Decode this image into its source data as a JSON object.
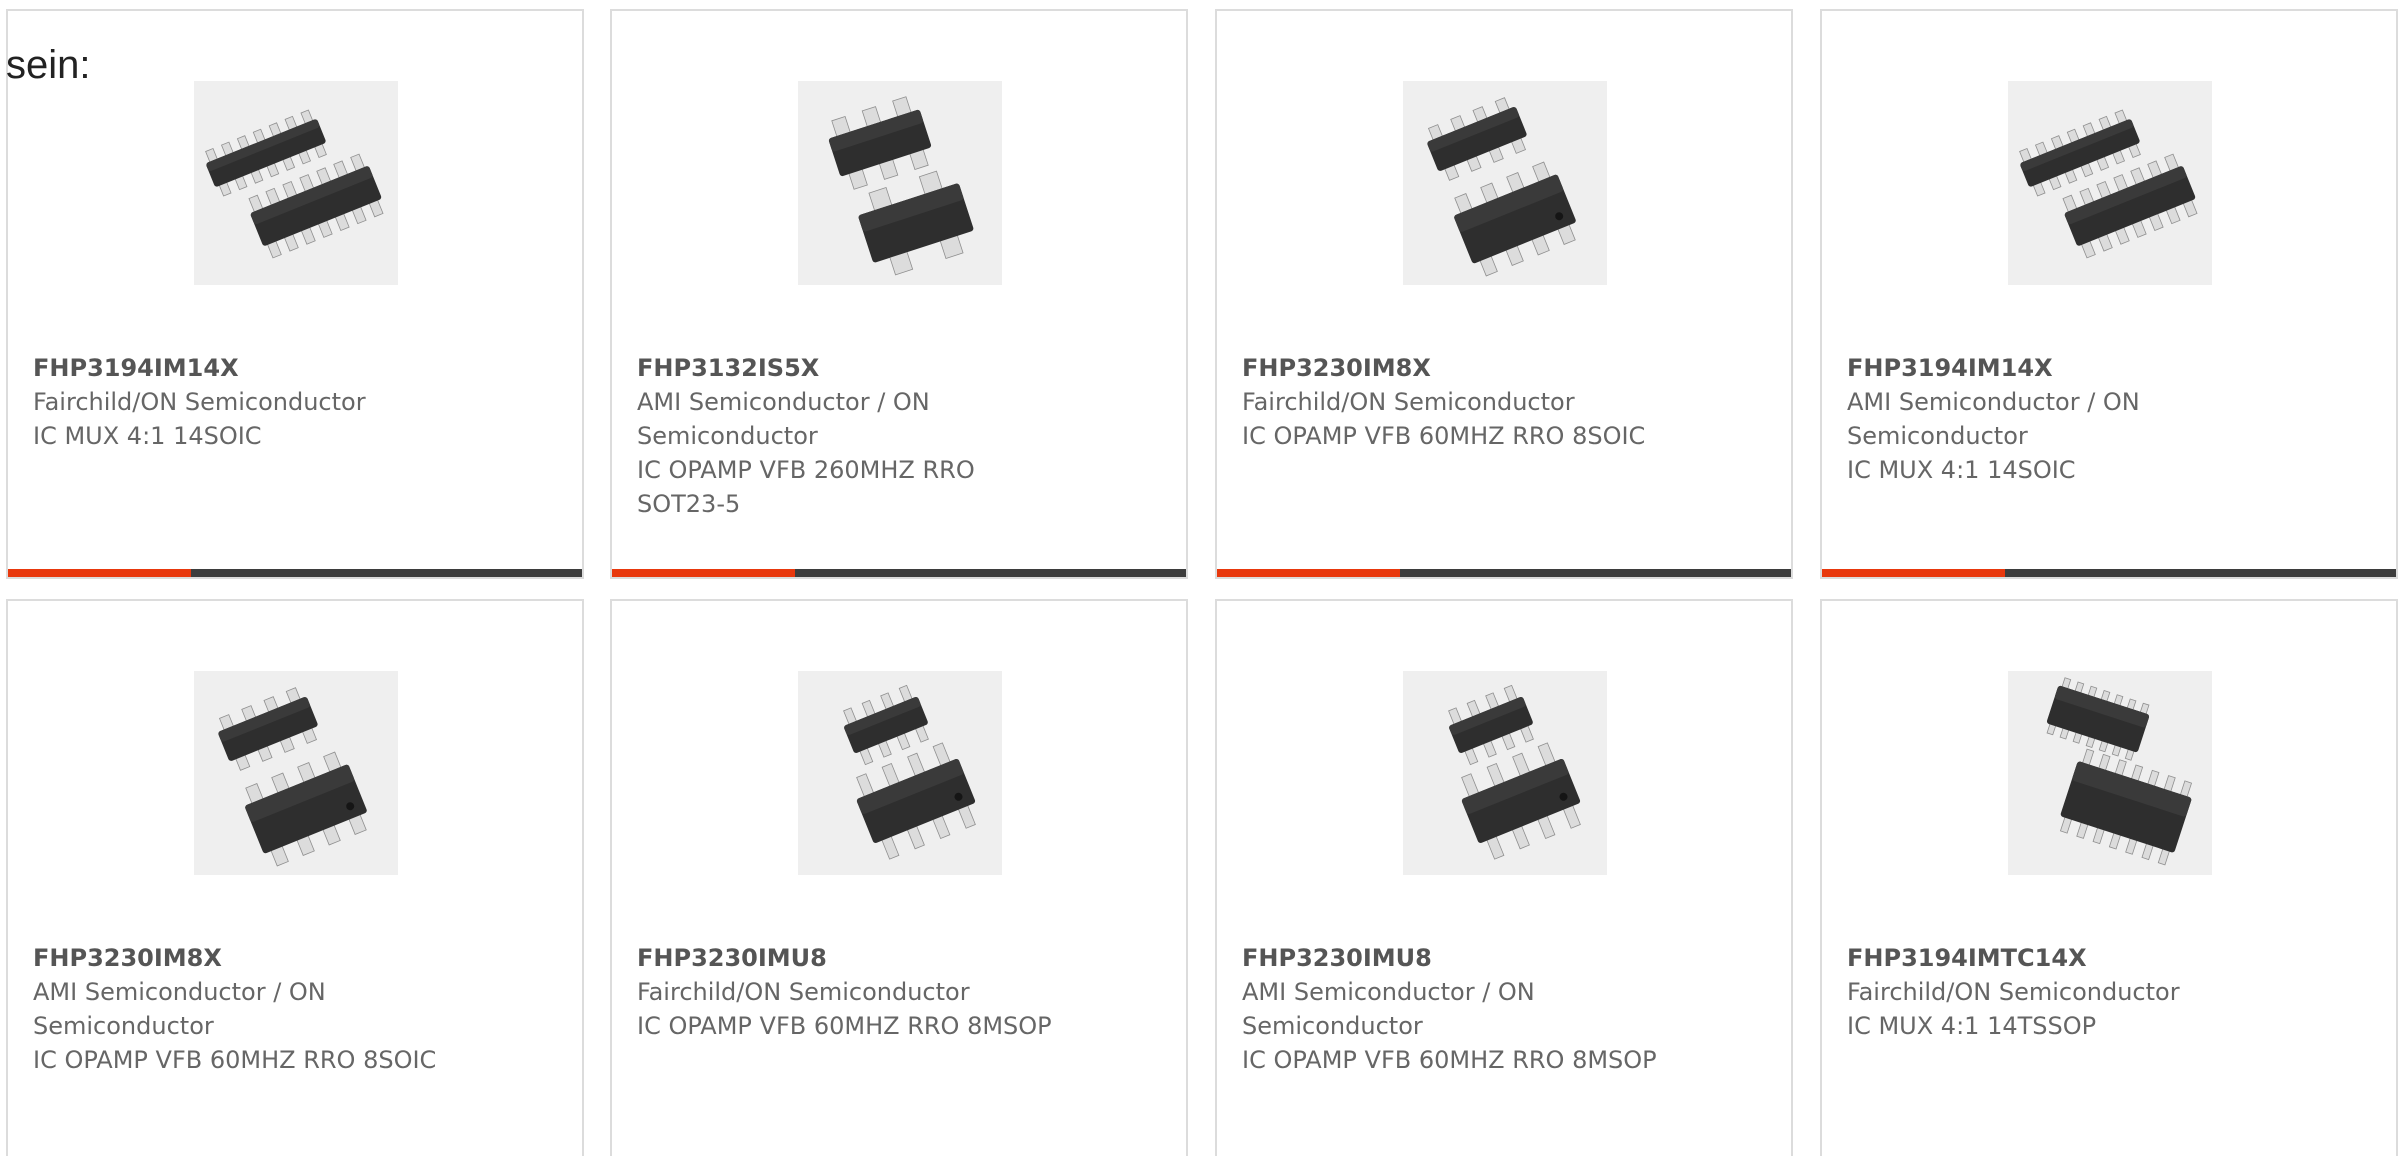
{
  "intro_text": "sein:",
  "colors": {
    "accent": "#e8380d",
    "bar": "#3d3d3d",
    "border": "#dcdcdc",
    "text": "#666666"
  },
  "products": [
    {
      "part": "FHP3194IM14X",
      "manufacturer": "Fairchild/ON Semiconductor",
      "description": "IC MUX 4:1 14SOIC",
      "image": "soic-14-package-icon"
    },
    {
      "part": "FHP3132IS5X",
      "manufacturer": "AMI Semiconductor / ON Semiconductor",
      "description": "IC OPAMP VFB 260MHZ RRO SOT23-5",
      "image": "sot23-5-package-icon"
    },
    {
      "part": "FHP3230IM8X",
      "manufacturer": "Fairchild/ON Semiconductor",
      "description": "IC OPAMP VFB 60MHZ RRO 8SOIC",
      "image": "soic-8-package-icon"
    },
    {
      "part": "FHP3194IM14X",
      "manufacturer": "AMI Semiconductor / ON Semiconductor",
      "description": "IC MUX 4:1 14SOIC",
      "image": "soic-14-package-icon"
    },
    {
      "part": "FHP3230IM8X",
      "manufacturer": "AMI Semiconductor / ON Semiconductor",
      "description": "IC OPAMP VFB 60MHZ RRO 8SOIC",
      "image": "soic-8-package-icon"
    },
    {
      "part": "FHP3230IMU8",
      "manufacturer": "Fairchild/ON Semiconductor",
      "description": "IC OPAMP VFB 60MHZ RRO 8MSOP",
      "image": "msop-8-package-icon"
    },
    {
      "part": "FHP3230IMU8",
      "manufacturer": "AMI Semiconductor / ON Semiconductor",
      "description": "IC OPAMP VFB 60MHZ RRO 8MSOP",
      "image": "msop-8-package-icon"
    },
    {
      "part": "FHP3194IMTC14X",
      "manufacturer": "Fairchild/ON Semiconductor",
      "description": "IC MUX 4:1 14TSSOP",
      "image": "tssop-14-package-icon"
    }
  ]
}
